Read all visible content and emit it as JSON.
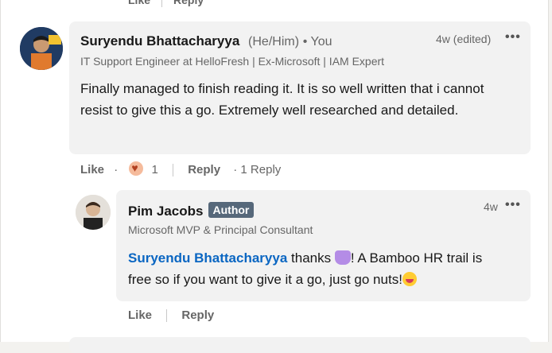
{
  "prev_comment": {
    "like_label": "Like",
    "reply_label": "Reply"
  },
  "comment": {
    "author": "Suryendu Bhattacharyya",
    "pronouns": "(He/Him)",
    "you_label": "• You",
    "headline": "IT Support Engineer at HelloFresh | Ex-Microsoft | IAM Expert",
    "time": "4w (edited)",
    "more_icon": "more-horizontal-icon",
    "body": "Finally managed to finish reading it. It is so well written that i cannot resist to give this a go. Extremely well researched and detailed.",
    "like_label": "Like",
    "dot_sep": "·",
    "reaction_count": "1",
    "reply_label": "Reply",
    "replies_label": "· 1 Reply"
  },
  "reply": {
    "author": "Pim Jacobs",
    "badge": "Author",
    "headline": "Microsoft MVP & Principal Consultant",
    "time": "4w",
    "more_icon": "more-horizontal-icon",
    "mention": "Suryendu Bhattacharyya",
    "text_part1": "thanks",
    "text_part2": "! A Bamboo HR trail is",
    "text_part3": "free so if you want to give it a go, just go nuts!",
    "like_label": "Like",
    "reply_label": "Reply"
  },
  "colors": {
    "link": "#0a66c2",
    "badge_bg": "#56687a",
    "bubble": "#f2f2f2"
  }
}
